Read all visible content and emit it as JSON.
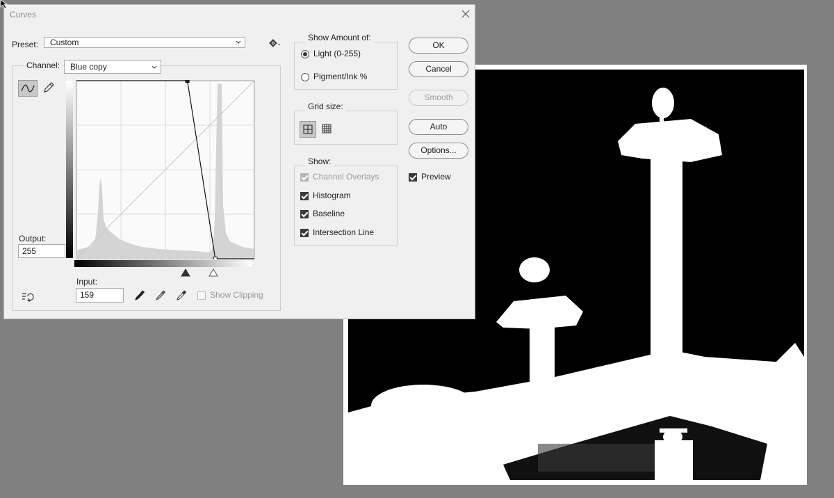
{
  "dialog": {
    "title": "Curves",
    "preset_label": "Preset:",
    "preset_value": "Custom",
    "channel_label": "Channel:",
    "channel_value": "Blue copy",
    "output_label": "Output:",
    "output_value": "255",
    "input_label": "Input:",
    "input_value": "159",
    "show_clipping_label": "Show Clipping"
  },
  "show_amount": {
    "title": "Show Amount of:",
    "light_label": "Light  (0-255)",
    "pigment_label": "Pigment/Ink %",
    "selected": "light"
  },
  "grid_size": {
    "title": "Grid size:",
    "selected": "simple"
  },
  "show": {
    "title": "Show:",
    "channel_overlays": {
      "label": "Channel Overlays",
      "checked": true,
      "enabled": false
    },
    "histogram": {
      "label": "Histogram",
      "checked": true
    },
    "baseline": {
      "label": "Baseline",
      "checked": true
    },
    "intersection_line": {
      "label": "Intersection Line",
      "checked": true
    }
  },
  "buttons": {
    "ok": "OK",
    "cancel": "Cancel",
    "smooth": "Smooth",
    "auto": "Auto",
    "options": "Options..."
  },
  "preview": {
    "label": "Preview",
    "checked": true
  },
  "curve": {
    "black_point_input": 159,
    "white_point_input": 199,
    "output_at_black_point": 255,
    "output_at_white_point": 0
  },
  "colors": {
    "dialog_bg": "#f0f0f0",
    "workspace_bg": "#808080"
  }
}
